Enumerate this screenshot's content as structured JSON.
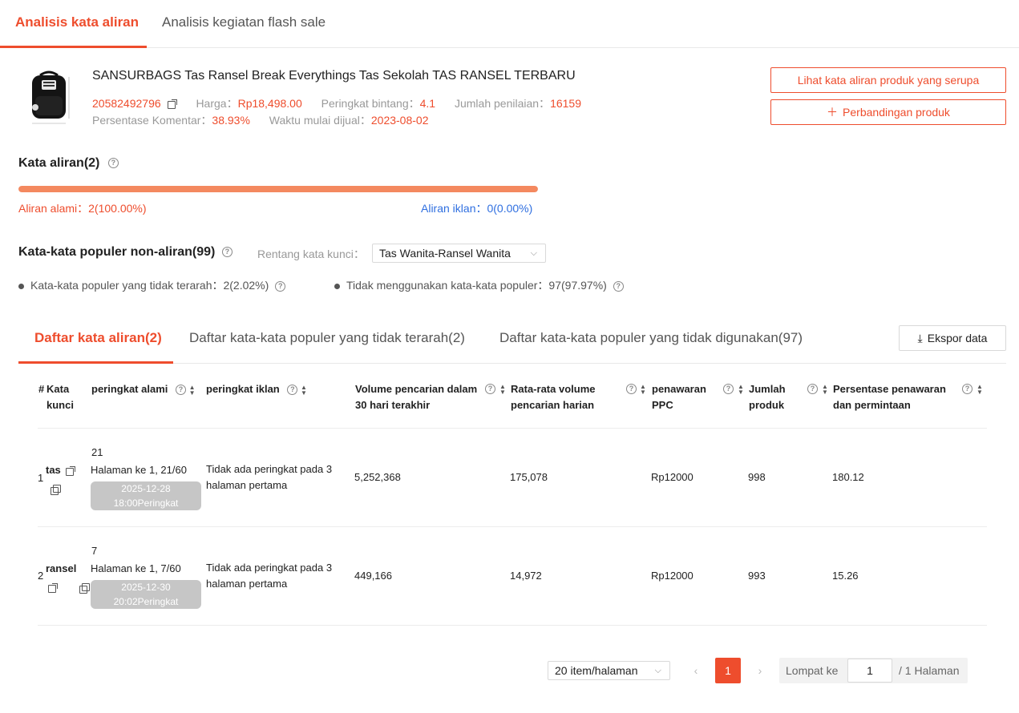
{
  "top_tabs": [
    "Analisis kata aliran",
    "Analisis kegiatan flash sale"
  ],
  "product": {
    "title": "SANSURBAGS Tas Ransel Break Everythings Tas Sekolah TAS RANSEL TERBARU",
    "id": "20582492796",
    "price_label": "Harga：",
    "price": "Rp18,498.00",
    "rating_label": "Peringkat bintang：",
    "rating": "4.1",
    "reviews_label": "Jumlah penilaian：",
    "reviews": "16159",
    "comment_pct_label": "Persentase Komentar：",
    "comment_pct": "38.93%",
    "start_label": "Waktu mulai dijual：",
    "start_date": "2023-08-02"
  },
  "buttons": {
    "similar": "Lihat kata aliran produk yang serupa",
    "compare": "Perbandingan produk",
    "export": "Ekspor data"
  },
  "traffic": {
    "title": "Kata aliran(2)",
    "organic_label": "Aliran alami：",
    "organic_value": "2(100.00%)",
    "organic_fraction": 1.0,
    "ads_label": "Aliran iklan：",
    "ads_value": "0(0.00%)"
  },
  "popular": {
    "title": "Kata-kata populer non-aliran(99)",
    "range_label": "Rentang kata kunci：",
    "range_value": "Tas Wanita-Ransel Wanita",
    "untargeted_label": "Kata-kata populer yang tidak terarah：",
    "untargeted_value": "2(2.02%)",
    "unused_label": "Tidak menggunakan kata-kata populer：",
    "unused_value": "97(97.97%)"
  },
  "list_tabs": [
    "Daftar kata aliran(2)",
    "Daftar kata-kata populer yang tidak terarah(2)",
    "Daftar kata-kata populer yang tidak digunakan(97)"
  ],
  "table": {
    "headers": {
      "index": "#",
      "keyword": "Kata kunci",
      "organic_rank": "peringkat alami",
      "ad_rank": "peringkat iklan",
      "volume30": "Volume pencarian dalam 30 hari terakhir",
      "daily": "Rata-rata volume pencarian harian",
      "ppc": "penawaran PPC",
      "products": "Jumlah produk",
      "ratio": "Persentase penawaran dan permintaan"
    },
    "rows": [
      {
        "index": "1",
        "keyword": "tas",
        "rank": "21",
        "rank_page": "Halaman ke 1, 21/60",
        "rank_badge_date": "2025-12-28",
        "rank_badge_time": "18:00Peringkat",
        "ad_rank": "Tidak ada peringkat pada 3 halaman pertama",
        "volume30": "5,252,368",
        "daily": "175,078",
        "ppc": "Rp12000",
        "products": "998",
        "ratio": "180.12"
      },
      {
        "index": "2",
        "keyword": "ransel",
        "rank": "7",
        "rank_page": "Halaman ke 1, 7/60",
        "rank_badge_date": "2025-12-30",
        "rank_badge_time": "20:02Peringkat",
        "ad_rank": "Tidak ada peringkat pada 3 halaman pertama",
        "volume30": "449,166",
        "daily": "14,972",
        "ppc": "Rp12000",
        "products": "993",
        "ratio": "15.26"
      }
    ]
  },
  "pagination": {
    "page_size": "20 item/halaman",
    "current": "1",
    "jump_label": "Lompat ke",
    "jump_value": "1",
    "total": "/ 1 Halaman"
  },
  "colors": {
    "accent": "#ee4d2d",
    "bar": "#f4895f",
    "blue": "#2f6fe0"
  }
}
